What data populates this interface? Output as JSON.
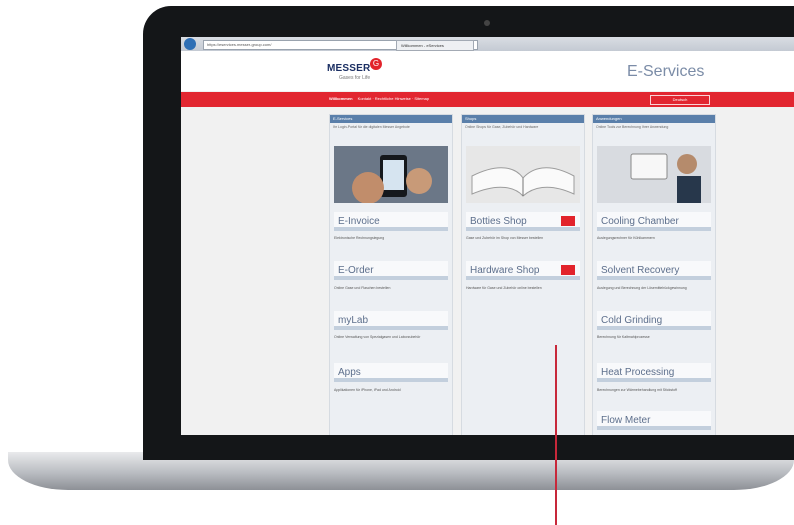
{
  "browser": {
    "url": "https://eservices.messer-group.com/",
    "tab": "Willkommen - eServices"
  },
  "header": {
    "logo": "MESSER",
    "logo_badge": "G",
    "logo_sub": "Gases for Life",
    "title": "E-Services"
  },
  "nav": {
    "active": "Willkommen",
    "items": [
      "Kontakt",
      "Rechtliche Hinweise",
      "Sitemap"
    ],
    "language": "Deutsch"
  },
  "columns": [
    {
      "heading": "E-Services",
      "subtitle": "Ihr Login-Portal für die digitalen Messer Angebote",
      "cards": [
        {
          "title": "E-Invoice",
          "desc": "Elektronische Rechnungslegung"
        },
        {
          "title": "E-Order",
          "desc": "Online Gase und Flaschen bestellen"
        },
        {
          "title": "myLab",
          "desc": "Online Verwaltung von Spezialgasen und Laborzubehör"
        },
        {
          "title": "Apps",
          "desc": "Applikationen für iPhone, iPad und Android"
        }
      ]
    },
    {
      "heading": "Shops",
      "subtitle": "Online Shops für Gase, Zubehör und Hardware",
      "cards": [
        {
          "title": "Botties Shop",
          "desc": "Gase und Zubehör im Shop von Messer bestellen"
        },
        {
          "title": "Hardware Shop",
          "desc": "Hardware für Gase und Zubehör online bestellen"
        }
      ]
    },
    {
      "heading": "Anwendungen",
      "subtitle": "Online Tools zur Berechnung Ihrer Anwendung",
      "cards": [
        {
          "title": "Cooling Chamber",
          "desc": "Auslegungsrechner für Kühlkammern"
        },
        {
          "title": "Solvent Recovery",
          "desc": "Auslegung und Berechnung der Lösemittelrückgewinnung"
        },
        {
          "title": "Cold Grinding",
          "desc": "Berechnung für Kaltmahlprozesse"
        },
        {
          "title": "Heat Processing",
          "desc": "Berechnungen zur Wärmebehandlung mit Stickstoff"
        },
        {
          "title": "Flow Meter",
          "desc": ""
        }
      ]
    }
  ],
  "colors": {
    "red": "#e22630",
    "column_header": "#5a7faa",
    "navy": "#1b2f63"
  }
}
